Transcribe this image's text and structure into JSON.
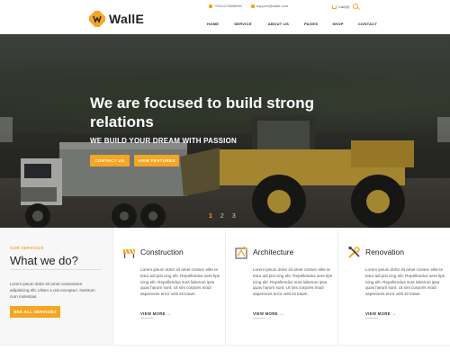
{
  "brand": {
    "logo_text": "WallE",
    "accent": "#f5a623"
  },
  "topbar": {
    "phone": "+0011278698981",
    "email": "support@walle.com",
    "cart": "Cart(0)"
  },
  "nav": {
    "items": [
      "HOME",
      "SERVICE",
      "ABOUT US",
      "PAGES",
      "SHOP",
      "CONTACT"
    ]
  },
  "hero": {
    "title": "We are focused to build strong relations",
    "subtitle": "WE BUILD YOUR DREAM WITH PASSION",
    "btn_contact": "CONTACT US",
    "btn_features": "VIEW FEATURES",
    "dots": [
      "1",
      "2",
      "3"
    ],
    "active_dot": 1
  },
  "intro": {
    "kicker": "OUR SERVICES",
    "heading": "What we do?",
    "text": "Lorem ipsum dolor sit amet consectetur adipisicing elit. Ullam a nisi excepturi. Nostrum cum molestias.",
    "button": "SEE ALL SERVICES"
  },
  "services": [
    {
      "icon": "construction-barrier-icon",
      "title": "Construction",
      "text": "Lorem ipsum dolor sit amet consec elite te tetur adi pisi cing elit. Repellendus sere lips icing elit. Repellendus sunt laborum ipsa quas harum sunt. Ut sint corporis modi asperiores error velit sit totam.",
      "more": "VIEW MORE →"
    },
    {
      "icon": "architecture-compass-icon",
      "title": "Architecture",
      "text": "Lorem ipsum dolor sit amet consec elite te tetur adi pisi cing elit. Repellendus sere lips icing elit. Repellendus sunt laborum ipsa quas harum sunt. Ut sint corporis modi asperiores error velit sit totam.",
      "more": "VIEW MORE →"
    },
    {
      "icon": "renovation-tools-icon",
      "title": "Renovation",
      "text": "Lorem ipsum dolor sit amet consec elite te tetur adi pisi cing elit. Repellendus sere lips icing elit. Repellendus sunt laborum ipsa quas harum sunt. Ut sint corporis modi asperiores error velit sit totam.",
      "more": "VIEW MORE →"
    }
  ]
}
